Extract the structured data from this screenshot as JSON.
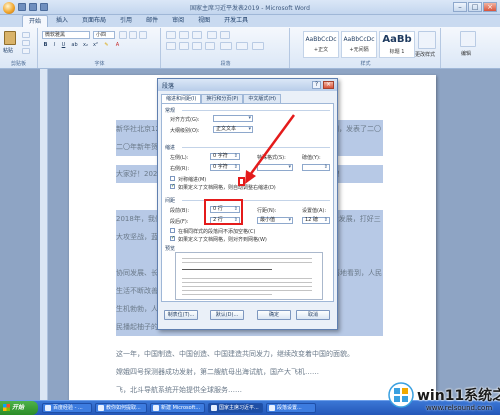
{
  "window": {
    "title": "国家主席习近平发表2019 - Microsoft Word"
  },
  "ribbon": {
    "tabs": [
      "开始",
      "插入",
      "页面布局",
      "引用",
      "邮件",
      "审阅",
      "视图",
      "开发工具"
    ],
    "active_tab": "开始",
    "groups": {
      "clipboard": "剪贴板",
      "font": "字体",
      "paragraph": "段落",
      "styles": "样式",
      "editing": "编辑"
    },
    "paste_label": "粘贴",
    "font_name": "微软雅黑",
    "font_size": "小四",
    "style_gallery": [
      {
        "sample": "AaBbCcDc",
        "name": "+正文"
      },
      {
        "sample": "AaBbCcDc",
        "name": "+无间隔"
      },
      {
        "sample": "AaBb",
        "name": "标题 1"
      }
    ],
    "change_styles_label": "更改样式",
    "edit_label": "编辑"
  },
  "document": {
    "paragraphs": [
      "新华社北京12月31日电 国家主席习近平通过中央广播电视总台和互联网，发表了二〇二〇年新年贺词。",
      "大家好！2020年的脚步越来越近，我在北京向大家致以新年的美好祝福！",
      "2018年，我们隆重庆祝改革开放40周年，全面深化改革推动经济高质量发展，打好三大攻坚战，蓝天、碧水、净土保卫战……",
      "协同发展、长江经济带发展、粤港澳大湾区建设……我在各地考察时欣喜地看到，人民生活不断改善。",
      "生机勃勃，人民群众奋斗的笑容，农民增收的喜悦，……",
      "民播起柚子的芬芳，最新时代春有希望……",
      "这一年，中国制造、中国创造、中国建造共同发力，继续改变着中国的面貌。",
      "嫦娥四号探测器成功发射，第二艘航母出海试航，国产大飞机……",
      "飞，北斗导航系统开始提供全球服务……"
    ]
  },
  "dialog": {
    "title": "段落",
    "help": "?",
    "close": "×",
    "tabs": [
      "缩进和间距(I)",
      "换行和分页(P)",
      "中文版式(H)"
    ],
    "active_tab": "缩进和间距(I)",
    "general": {
      "title": "常规",
      "alignment_label": "对齐方式(G):",
      "alignment_value": "",
      "outline_label": "大纲级别(O):",
      "outline_value": "正文文本"
    },
    "indent": {
      "title": "缩进",
      "left_label": "左侧(L):",
      "left_value": "0 字符",
      "right_label": "右侧(R):",
      "right_value": "0 字符",
      "special_label": "特殊格式(S):",
      "special_value": "",
      "by_label": "磅值(Y):",
      "by_value": "",
      "mirror_label": "对称缩进(M)",
      "mirror_checked": false,
      "auto_right_label": "如果定义了文档网格，则自动调整右缩进(D)",
      "auto_right_checked": true
    },
    "spacing": {
      "title": "间距",
      "before_label": "段前(B):",
      "before_value": "0 行",
      "after_label": "段后(F):",
      "after_value": "2 行",
      "line_label": "行距(N):",
      "line_value": "最小值",
      "at_label": "设置值(A):",
      "at_value": "12 磅",
      "no_space_label": "在相同样式的段落间不添加空格(C)",
      "no_space_checked": false,
      "snap_grid_label": "如果定义了文档网格，则对齐到网格(W)",
      "snap_grid_checked": true
    },
    "preview": {
      "title": "预览"
    },
    "buttons": {
      "tabs": "制表位(T)...",
      "default": "默认(D)...",
      "ok": "确定",
      "cancel": "取消"
    }
  },
  "taskbar": {
    "start": "开始",
    "items": [
      "百度经验 - ...",
      "教你如何提取...",
      "新建 Microsoft...",
      "国家主席习近平...",
      "段落设置..."
    ]
  },
  "watermark": {
    "title": "win11系统之家",
    "url": "www.relsound.com"
  },
  "colors": {
    "annotation": "#e41b1b",
    "selection": "#b7c9e6",
    "ribbon": "#dbe7f6"
  }
}
